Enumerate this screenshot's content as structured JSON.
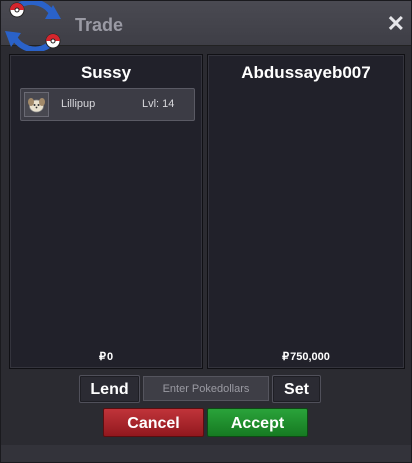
{
  "window": {
    "title": "Trade",
    "close_glyph": "✕",
    "logo_icon": "pokeball-swap-icon"
  },
  "left_panel": {
    "player_name": "Sussy",
    "items": [
      {
        "icon": "lillipup-icon",
        "name": "Lillipup",
        "level": "Lvl: 14"
      }
    ],
    "currency_symbol": "₽",
    "money": "0"
  },
  "right_panel": {
    "player_name": "Abdussayeb007",
    "items": [],
    "currency_symbol": "₽",
    "money": "750,000"
  },
  "controls": {
    "lend_label": "Lend",
    "pokedollar_placeholder": "Enter Pokedollars",
    "set_label": "Set",
    "cancel_label": "Cancel",
    "accept_label": "Accept"
  },
  "colors": {
    "cancel": "#b3282e",
    "accept": "#22953a",
    "panel_bg": "#21212a",
    "titlebar": "#44444c"
  }
}
